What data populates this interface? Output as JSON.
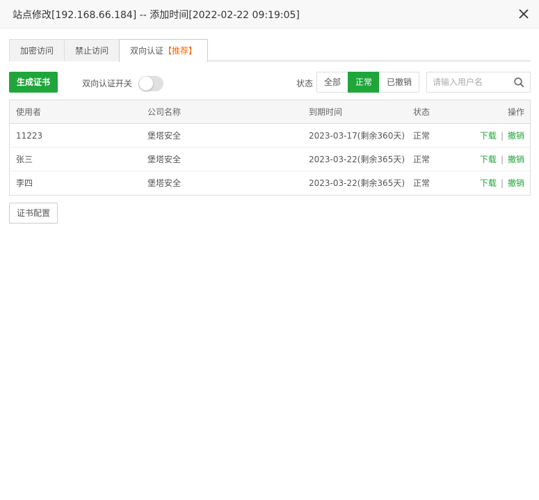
{
  "dialog": {
    "title": "站点修改[192.168.66.184] -- 添加时间[2022-02-22 09:19:05]"
  },
  "tabs": [
    {
      "label": "加密访问"
    },
    {
      "label": "禁止访问"
    },
    {
      "label": "双向认证",
      "badge": "【推荐】",
      "active": true
    }
  ],
  "toolbar": {
    "generate_label": "生成证书",
    "switch_label": "双向认证开关",
    "switch_on": false,
    "status_label": "状态",
    "filters": [
      "全部",
      "正常",
      "已撤销"
    ],
    "active_filter": "正常",
    "search_placeholder": "请输入用户名",
    "search_value": ""
  },
  "table": {
    "headers": [
      "使用者",
      "公司名称",
      "到期时间",
      "状态",
      "操作"
    ],
    "rows": [
      {
        "user": "11223",
        "company": "堡塔安全",
        "expiry": "2023-03-17(剩余360天)",
        "status": "正常",
        "download": "下载",
        "revoke": "撤销"
      },
      {
        "user": "张三",
        "company": "堡塔安全",
        "expiry": "2023-03-22(剩余365天)",
        "status": "正常",
        "download": "下载",
        "revoke": "撤销"
      },
      {
        "user": "李四",
        "company": "堡塔安全",
        "expiry": "2023-03-22(剩余365天)",
        "status": "正常",
        "download": "下载",
        "revoke": "撤销"
      }
    ],
    "op_separator": "|"
  },
  "footer": {
    "config_label": "证书配置"
  },
  "colors": {
    "accent": "#20a53a",
    "badge": "#ff6600"
  },
  "icons": {
    "close": "close-icon",
    "search": "search-icon"
  }
}
